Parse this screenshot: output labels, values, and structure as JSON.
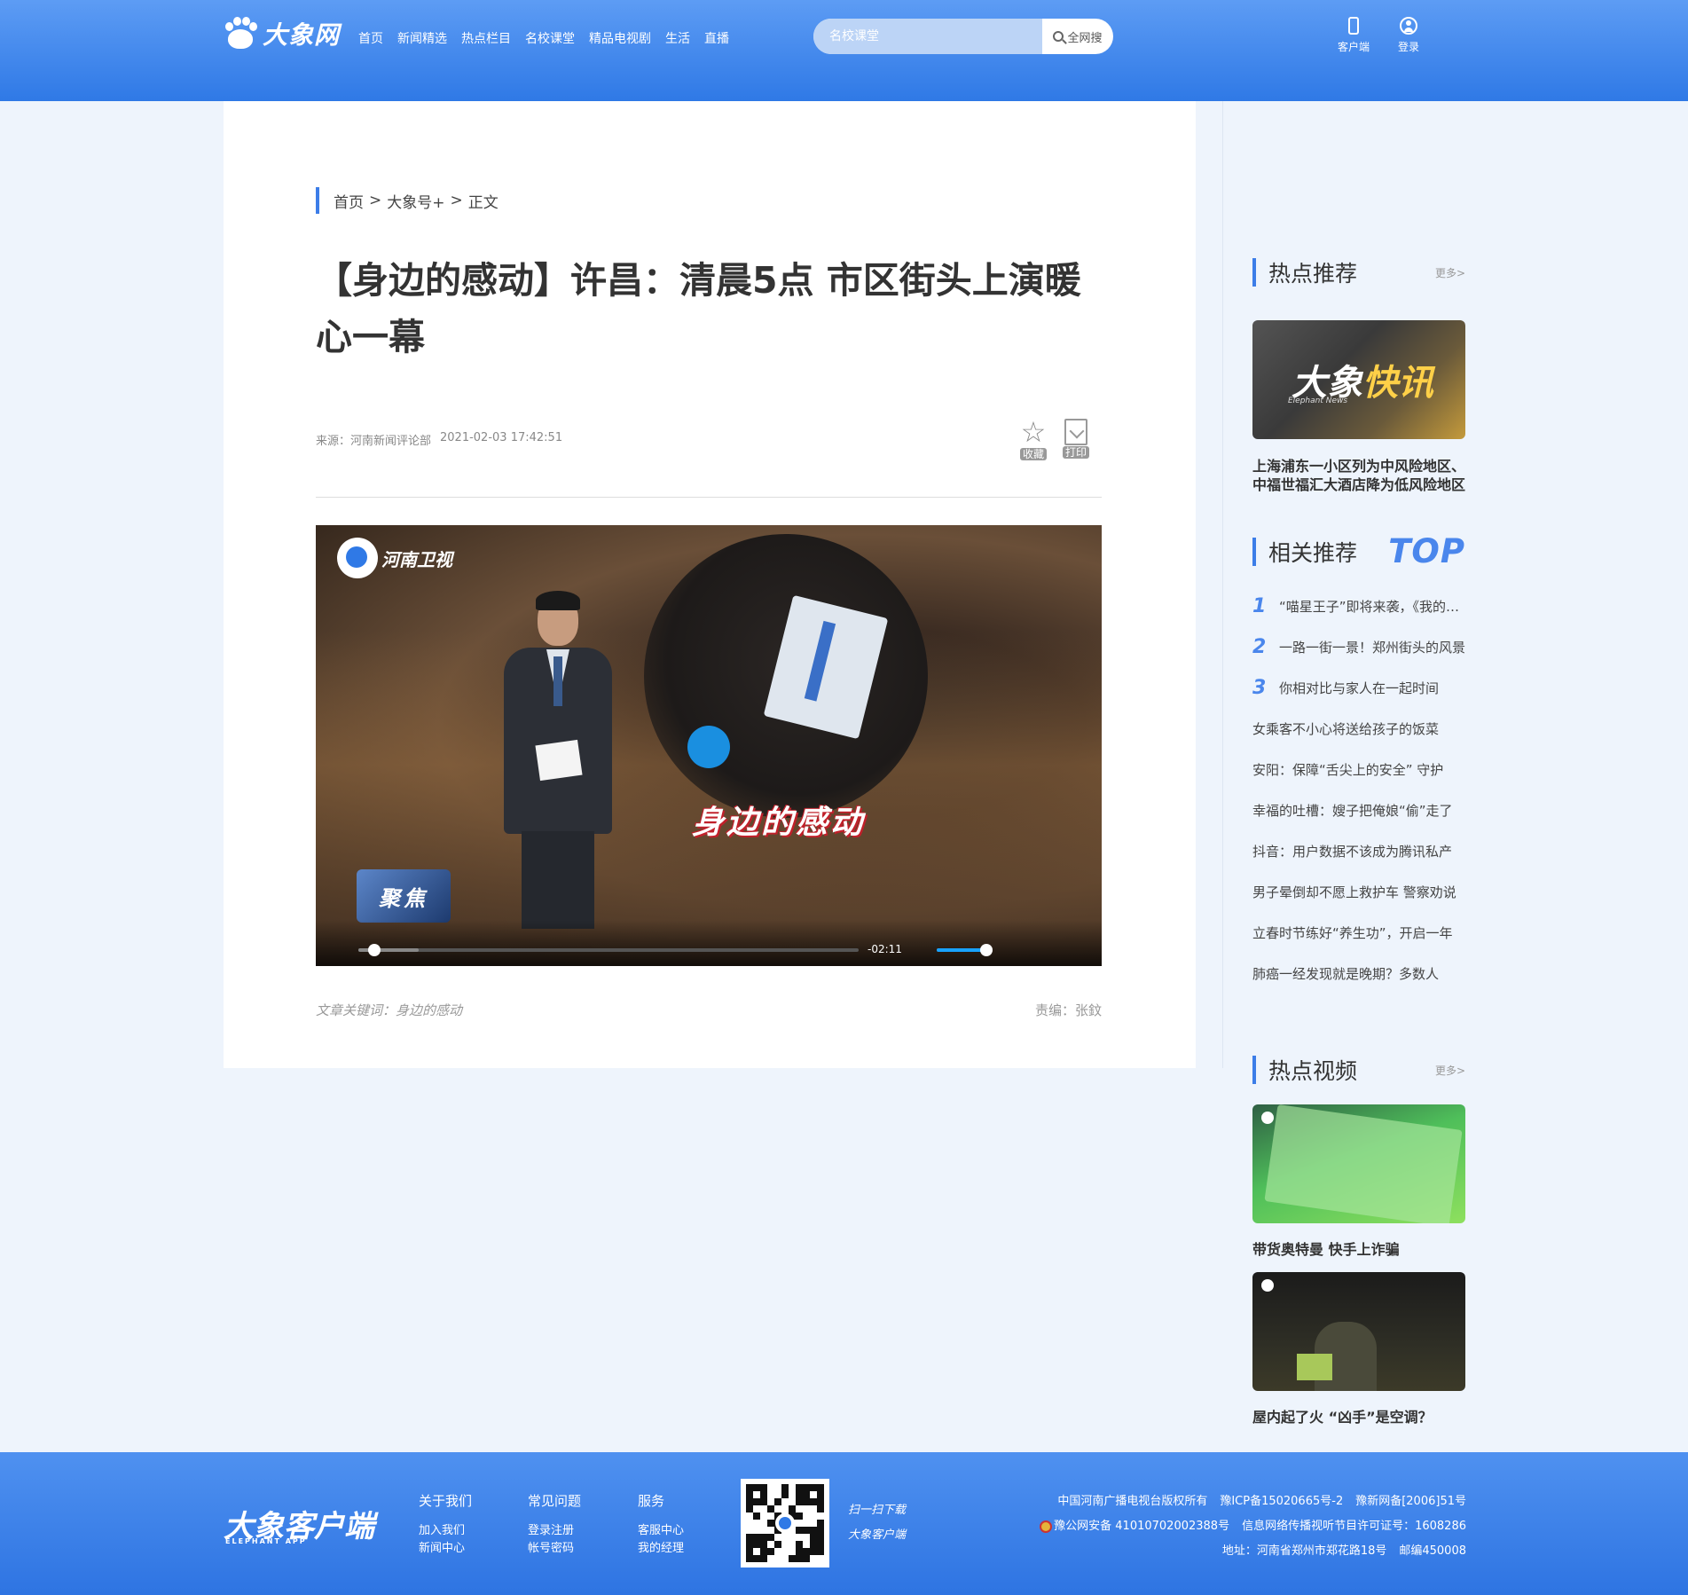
{
  "header": {
    "logo": "大象网",
    "nav": [
      "首页",
      "新闻精选",
      "热点栏目",
      "名校课堂",
      "精品电视剧",
      "生活",
      "直播"
    ],
    "search_placeholder": "名校课堂",
    "search_button": "全网搜",
    "client_label": "客户端",
    "login_label": "登录"
  },
  "article": {
    "breadcrumb": [
      "首页",
      "大象号+",
      "正文"
    ],
    "breadcrumb_sep": ">",
    "title": "【身边的感动】许昌：清晨5点 市区街头上演暖心一幕",
    "source": "来源：河南新闻评论部",
    "datetime": "2021-02-03 17:42:51",
    "favorite_label": "收藏",
    "print_label": "打印",
    "video": {
      "channel": "河南卫视",
      "caption": "身边的感动",
      "segment": "聚焦",
      "time_remaining": "-02:11",
      "progress": 0.02,
      "buffered": 0.12,
      "volume": 0.9
    },
    "keywords": "文章关键词：身边的感动",
    "editor": "责编：张鈫"
  },
  "sidebar": {
    "hot": {
      "title": "热点推荐",
      "more": "更多>",
      "thumb_title": "大象",
      "thumb_title_accent": "快讯",
      "thumb_sub": "Elephant News",
      "caption": "上海浦东一小区列为中风险地区、中福世福汇大酒店降为低风险地区"
    },
    "related": {
      "title": "相关推荐",
      "badge": "TOP",
      "items": [
        {
          "num": "1",
          "text": "“喵星王子”即将来袭，《我的喵星王子》"
        },
        {
          "num": "2",
          "text": "一路一街一景！郑州街头的风景"
        },
        {
          "num": "3",
          "text": "你相对比与家人在一起时间"
        },
        {
          "num": "",
          "text": "女乘客不小心将送给孩子的饭菜"
        },
        {
          "num": "",
          "text": "安阳：保障“舌尖上的安全” 守护"
        },
        {
          "num": "",
          "text": "幸福的吐槽：嫂子把俺娘“偷”走了"
        },
        {
          "num": "",
          "text": "抖音：用户数据不该成为腾讯私产"
        },
        {
          "num": "",
          "text": "男子晕倒却不愿上救护车 警察劝说"
        },
        {
          "num": "",
          "text": "立春时节练好“养生功”，开启一年"
        },
        {
          "num": "",
          "text": "肺癌一经发现就是晚期？多数人"
        }
      ]
    },
    "videos": {
      "title": "热点视频",
      "more": "更多>",
      "items": [
        {
          "caption": "带货奥特曼 快手上诈骗"
        },
        {
          "caption": "屋内起了火 “凶手”是空调？"
        }
      ]
    }
  },
  "footer": {
    "logo": "大象客户端",
    "logo_sub": "ELEPHANT APP",
    "cols": [
      {
        "title": "关于我们",
        "links": [
          "加入我们",
          "新闻中心"
        ]
      },
      {
        "title": "常见问题",
        "links": [
          "登录注册",
          "帐号密码"
        ]
      },
      {
        "title": "服务",
        "links": [
          "客服中心",
          "我的经理"
        ]
      }
    ],
    "scan_1": "扫一扫下载",
    "scan_2": "大象客户端",
    "copyright": "中国河南广播电视台版权所有",
    "icp": "豫ICP备15020665号-2",
    "netnum": "豫新网备[2006]51号",
    "police": "豫公网安备 41010702002388号",
    "license": "信息网络传播视听节目许可证号：1608286",
    "address": "地址：河南省郑州市郑花路18号",
    "postcode": "邮编450008"
  }
}
